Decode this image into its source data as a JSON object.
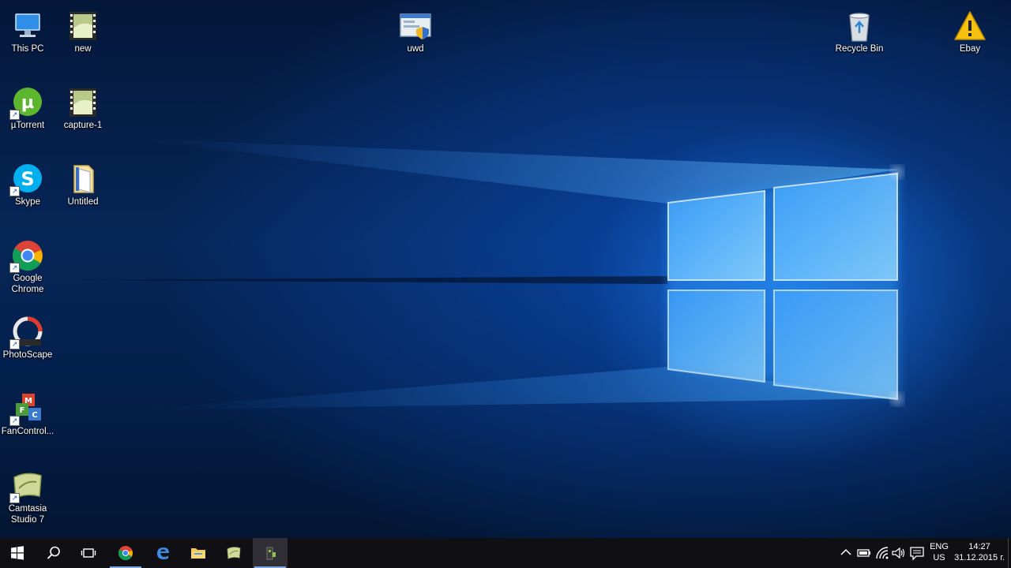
{
  "desktop": {
    "icons": [
      {
        "id": "this-pc",
        "label": "This PC",
        "icon": "computer-icon"
      },
      {
        "id": "new",
        "label": "new",
        "icon": "video-file-icon"
      },
      {
        "id": "utorrent",
        "label": "µTorrent",
        "icon": "utorrent-icon"
      },
      {
        "id": "capture-1",
        "label": "capture-1",
        "icon": "video-file-icon"
      },
      {
        "id": "skype",
        "label": "Skype",
        "icon": "skype-icon"
      },
      {
        "id": "untitled",
        "label": "Untitled",
        "icon": "document-icon"
      },
      {
        "id": "google-chrome",
        "label": "Google\nChrome",
        "icon": "chrome-icon"
      },
      {
        "id": "photoscape",
        "label": "PhotoScape",
        "icon": "photoscape-icon"
      },
      {
        "id": "fancontrol",
        "label": "FanControl...",
        "icon": "fancontrol-icon"
      },
      {
        "id": "camtasia",
        "label": "Camtasia\nStudio 7",
        "icon": "camtasia-icon"
      },
      {
        "id": "uwd",
        "label": "uwd",
        "icon": "uwd-icon"
      },
      {
        "id": "recycle-bin",
        "label": "Recycle Bin",
        "icon": "recycle-bin-icon"
      },
      {
        "id": "ebay",
        "label": "Ebay",
        "icon": "warning-icon"
      }
    ]
  },
  "taskbar": {
    "buttons": [
      {
        "name": "start",
        "icon": "windows-logo-icon"
      },
      {
        "name": "search",
        "icon": "search-icon"
      },
      {
        "name": "task-view",
        "icon": "task-view-icon"
      },
      {
        "name": "chrome",
        "icon": "chrome-icon"
      },
      {
        "name": "edge",
        "icon": "edge-icon"
      },
      {
        "name": "file-explorer",
        "icon": "folder-icon"
      },
      {
        "name": "camtasia",
        "icon": "camtasia-icon"
      },
      {
        "name": "recorder",
        "icon": "recorder-icon",
        "active": true
      }
    ],
    "tray": {
      "icons": [
        "chevron-up-icon",
        "battery-icon",
        "wifi-icon",
        "volume-icon",
        "notification-icon"
      ],
      "language": "ENG",
      "layout": "US",
      "time": "14:27",
      "date": "31.12.2015 г."
    }
  },
  "colors": {
    "taskbar_bg": "#101014",
    "accent": "#1e90ff"
  }
}
